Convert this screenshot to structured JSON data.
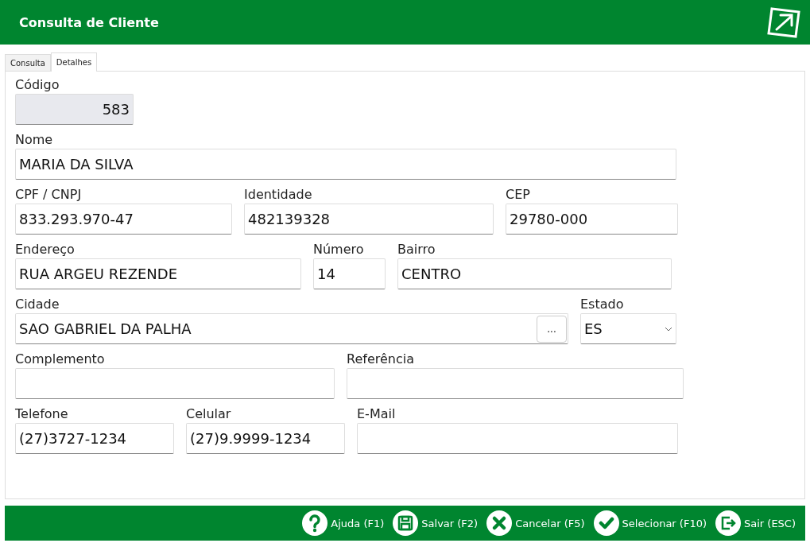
{
  "window": {
    "title": "Consulta de Cliente"
  },
  "tabs": [
    {
      "label": "Consulta",
      "selected": false
    },
    {
      "label": "Detalhes",
      "selected": true
    }
  ],
  "rows": [
    [
      {
        "kind": "readonly",
        "label": "Código",
        "value": "583"
      }
    ],
    [
      {
        "kind": "text",
        "label": "Nome",
        "value": "MARIA DA SILVA"
      }
    ],
    [
      {
        "kind": "text",
        "label": "CPF / CNPJ",
        "value": "833.293.970-47"
      },
      {
        "kind": "text",
        "label": "Identidade",
        "value": "482139328"
      },
      {
        "kind": "text",
        "label": "CEP",
        "value": "29780-000"
      }
    ],
    [
      {
        "kind": "text",
        "label": "Endereço",
        "value": "RUA ARGEU REZENDE"
      },
      {
        "kind": "text",
        "label": "Número",
        "value": "14"
      },
      {
        "kind": "text",
        "label": "Bairro",
        "value": "CENTRO"
      }
    ],
    [
      {
        "kind": "lookup",
        "label": "Cidade",
        "value": "SAO GABRIEL DA PALHA",
        "button": "..."
      },
      {
        "kind": "select",
        "label": "Estado",
        "value": "ES"
      }
    ],
    [
      {
        "kind": "text",
        "label": "Complemento"
      },
      {
        "kind": "text",
        "label": "Referência"
      }
    ],
    [
      {
        "kind": "text",
        "label": "Telefone",
        "value": "(27)3727-1234"
      },
      {
        "kind": "text",
        "label": "Celular",
        "value": "(27)9.9999-1234"
      },
      {
        "kind": "text",
        "label": "E-Mail"
      }
    ]
  ],
  "actions": [
    {
      "kind": "help",
      "label": "Ajuda (F1)"
    },
    {
      "kind": "save",
      "label": "Salvar (F2)"
    },
    {
      "kind": "cancel",
      "label": "Cancelar (F5)"
    },
    {
      "kind": "select",
      "label": "Selecionar (F10)"
    },
    {
      "kind": "exit",
      "label": "Sair (ESC)"
    }
  ]
}
